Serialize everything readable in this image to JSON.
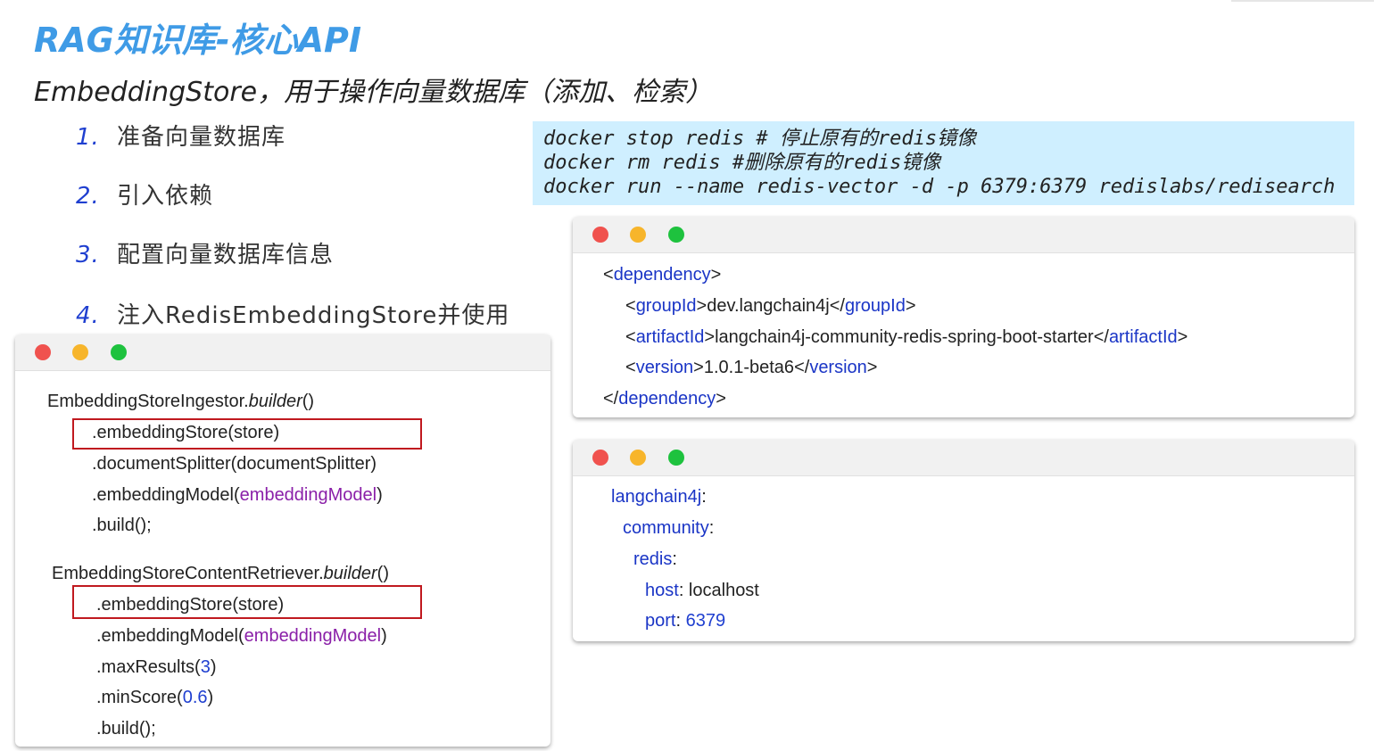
{
  "title": "RAG知识库-核心API",
  "subtitle": "EmbeddingStore，用于操作向量数据库（添加、检索）",
  "steps": [
    {
      "num": "1.",
      "text": "准备向量数据库"
    },
    {
      "num": "2.",
      "text": "引入依赖"
    },
    {
      "num": "3.",
      "text": "配置向量数据库信息"
    },
    {
      "num": "4.",
      "text": "注入RedisEmbeddingStore并使用"
    }
  ],
  "commands": [
    "docker stop redis # 停止原有的redis镜像",
    "docker rm redis #删除原有的redis镜像",
    "docker run --name redis-vector -d -p 6379:6379 redislabs/redisearch"
  ],
  "java_code": {
    "ingestor_class": "EmbeddingStoreIngestor.",
    "builder": "builder",
    "parens": "()",
    "ingestor_lines": [
      ".embeddingStore(store)",
      ".documentSplitter(documentSplitter)",
      ".embeddingModel(",
      "embeddingModel",
      ")",
      ".build();"
    ],
    "retriever_class": "EmbeddingStoreContentRetriever.",
    "retriever_lines": {
      "store": ".embeddingStore(store)",
      "model_pre": ".embeddingModel(",
      "model_arg": "embeddingModel",
      "model_post": ")",
      "max_pre": ".maxResults(",
      "max_val": "3",
      "max_post": ")",
      "min_pre": ".minScore(",
      "min_val": "0.6",
      "min_post": ")",
      "build": ".build();"
    }
  },
  "xml_code": {
    "lt": "<",
    "gt": ">",
    "lts": "</",
    "dependency": "dependency",
    "groupId": "groupId",
    "groupId_val": "dev.langchain4j",
    "artifactId": "artifactId",
    "artifactId_val": "langchain4j-community-redis-spring-boot-starter",
    "version": "version",
    "version_val": "1.0.1-beta6"
  },
  "yaml_code": {
    "langchain4j": "langchain4j",
    "community": "community",
    "redis": "redis",
    "host": "host",
    "host_val": " localhost",
    "port": "port",
    "port_val": "6379",
    "colon": ":"
  },
  "colors": {
    "title": "#3f9be6",
    "keyword": "#1a35c6",
    "purple": "#8a1fa8",
    "highlight_border": "#c0191f",
    "cmd_bg": "#cfefff"
  }
}
